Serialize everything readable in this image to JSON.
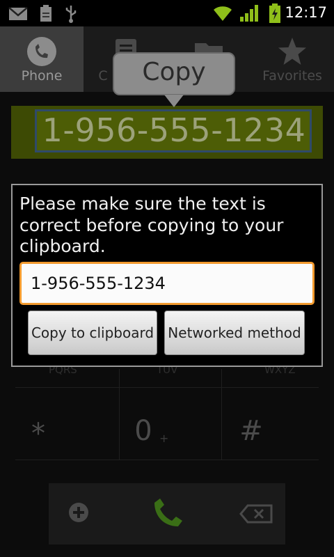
{
  "status_bar": {
    "time": "12:17",
    "icons": [
      "gmail-icon",
      "clipboard-icon",
      "usb-icon",
      "wifi-icon",
      "signal-icon",
      "battery-icon"
    ]
  },
  "tabs": [
    {
      "label": "Phone",
      "icon": "phone-icon",
      "active": true
    },
    {
      "label": "C",
      "icon": "contacts-icon",
      "active": false
    },
    {
      "label": "",
      "icon": "folder-icon",
      "active": false
    },
    {
      "label": "Favorites",
      "icon": "star-icon",
      "active": false
    }
  ],
  "copy_popup": {
    "label": "Copy"
  },
  "dialer": {
    "number": "1-956-555-1234",
    "keys": {
      "star": "*",
      "zero": "0",
      "zero_sub": "+",
      "hash": "#"
    },
    "row_partial": {
      "left": "PQRS",
      "middle": "TUV",
      "right": "WXYZ"
    }
  },
  "dialog": {
    "message": "Please make sure the text is correct before copying to your clipboard.",
    "input_value": "1-956-555-1234",
    "copy_button": "Copy to clipboard",
    "networked_button": "Networked method"
  },
  "colors": {
    "accent_orange": "#f29a2e",
    "number_bar_green": "#3d4a04",
    "call_green": "#3a6e16"
  }
}
